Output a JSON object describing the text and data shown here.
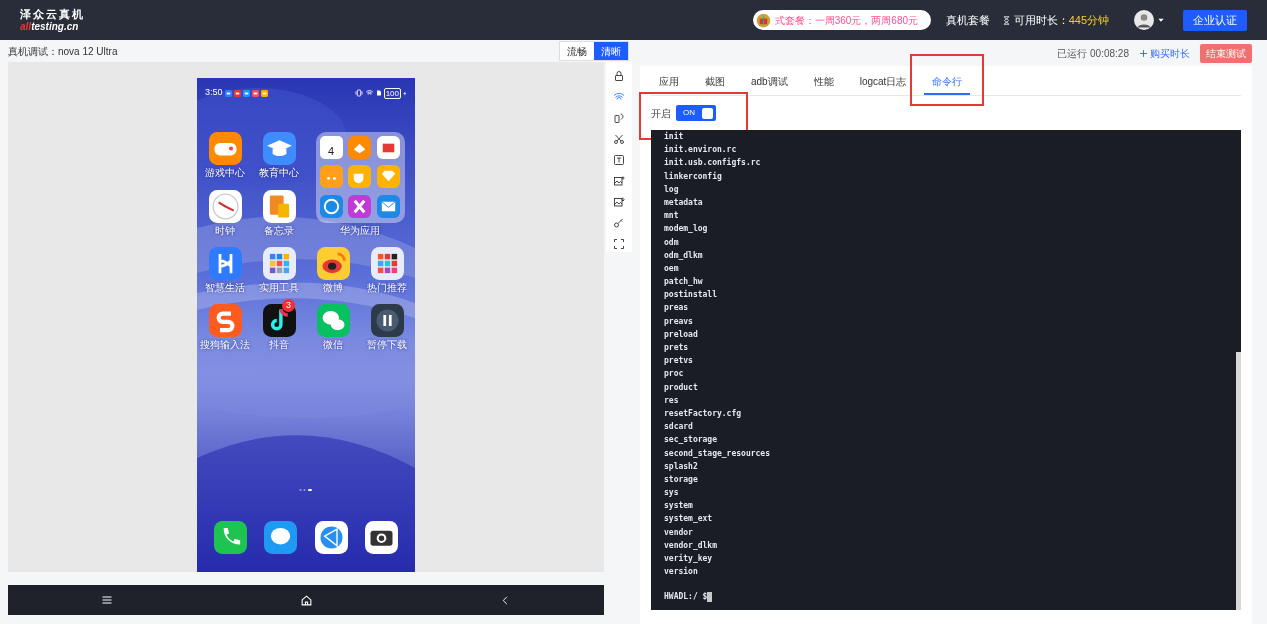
{
  "header": {
    "logo_title": "泽众云真机",
    "logo_sub_accent": "all",
    "logo_sub": "testing.cn",
    "promo": "式套餐：一周360元，两周680元",
    "plan_link": "真机套餐",
    "time_label": "可用时长：",
    "time_value": "445分钟",
    "cert_button": "企业认证"
  },
  "device": {
    "title": "真机调试：nova 12 Ultra",
    "quality": [
      {
        "label": "流畅",
        "selected": false
      },
      {
        "label": "清晰",
        "selected": true
      }
    ]
  },
  "phone": {
    "time": "3:50",
    "battery": "100",
    "apps": [
      {
        "label": "游戏中心"
      },
      {
        "label": "教育中心"
      },
      {
        "label": "时钟"
      },
      {
        "label": "备忘录"
      },
      {
        "label": "智慧生活"
      },
      {
        "label": "实用工具"
      },
      {
        "label": "微博"
      },
      {
        "label": "热门推荐"
      },
      {
        "label": "搜狗输入法"
      },
      {
        "label": "抖音",
        "badge": "3"
      },
      {
        "label": "微信"
      },
      {
        "label": "暂停下载"
      }
    ],
    "folder": {
      "label": "华为应用",
      "calendar_day": "4"
    }
  },
  "session": {
    "elapsed": "已运行 00:08:28",
    "buy": "购买时长",
    "end_button": "结束测试"
  },
  "tabs": [
    {
      "label": "应用",
      "selected": false,
      "highlighted": false
    },
    {
      "label": "截图",
      "selected": false,
      "highlighted": false
    },
    {
      "label": "adb调试",
      "selected": false,
      "highlighted": false
    },
    {
      "label": "性能",
      "selected": false,
      "highlighted": false
    },
    {
      "label": "logcat日志",
      "selected": false,
      "highlighted": false
    },
    {
      "label": "命令行",
      "selected": true,
      "highlighted": true
    }
  ],
  "shell": {
    "label": "开启",
    "toggle_text": "ON",
    "on": true,
    "highlighted": true,
    "lines": [
      "init",
      "init.environ.rc",
      "init.usb.configfs.rc",
      "linkerconfig",
      "log",
      "metadata",
      "mnt",
      "modem_log",
      "odm",
      "odm_dlkm",
      "oem",
      "patch_hw",
      "postinstall",
      "preas",
      "preavs",
      "preload",
      "prets",
      "pretvs",
      "proc",
      "product",
      "res",
      "resetFactory.cfg",
      "sdcard",
      "sec_storage",
      "second_stage_resources",
      "splash2",
      "storage",
      "sys",
      "system",
      "system_ext",
      "vendor",
      "vendor_dlkm",
      "verity_key",
      "version"
    ],
    "prompt": "HWADL:/ $"
  }
}
